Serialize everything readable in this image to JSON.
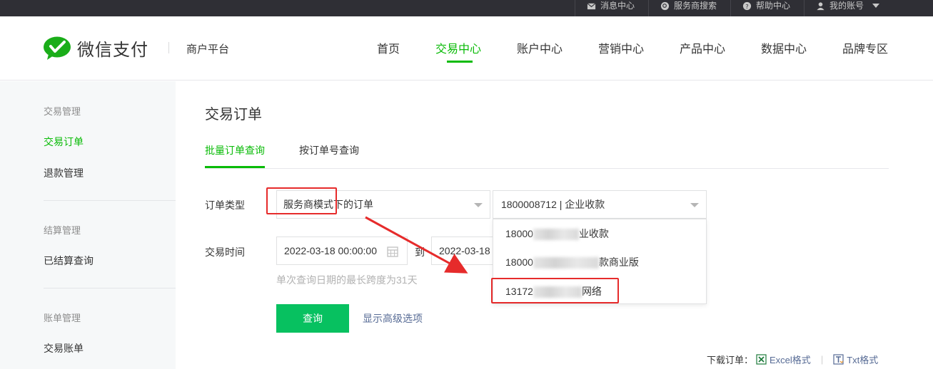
{
  "topbar": {
    "items": [
      "消息中心",
      "服务商搜索",
      "帮助中心",
      "我的账号"
    ]
  },
  "header": {
    "logo_text": "微信支付",
    "platform": "商户平台",
    "nav": [
      "首页",
      "交易中心",
      "账户中心",
      "营销中心",
      "产品中心",
      "数据中心",
      "品牌专区"
    ],
    "active_nav": "交易中心"
  },
  "sidebar": {
    "groups": [
      {
        "title": "交易管理",
        "items": [
          "交易订单",
          "退款管理"
        ]
      },
      {
        "title": "结算管理",
        "items": [
          "已结算查询"
        ]
      },
      {
        "title": "账单管理",
        "items": [
          "交易账单"
        ]
      }
    ],
    "active_item": "交易订单"
  },
  "main": {
    "title": "交易订单",
    "tabs": [
      "批量订单查询",
      "按订单号查询"
    ],
    "active_tab": "批量订单查询",
    "order_type_label": "订单类型",
    "order_type_value": "服务商模式下的订单",
    "merchant_value": "1800008712 | 企业收款",
    "merchant_options": [
      {
        "prefix": "18000",
        "suffix": "业收款"
      },
      {
        "prefix": "18000",
        "suffix": "款商业版"
      },
      {
        "prefix": "13172",
        "suffix": "网络"
      }
    ],
    "time_label": "交易时间",
    "start_time": "2022-03-18 00:00:00",
    "to_label": "到",
    "end_time": "2022-03-18",
    "hint": "单次查询日期的最长跨度为31天",
    "query_button": "查询",
    "advanced_link": "显示高级选项"
  },
  "download": {
    "label": "下载订单：",
    "excel": "Excel格式",
    "separator": "|",
    "txt": "Txt格式"
  },
  "colors": {
    "brand_green": "#09bb07",
    "button_green": "#07c160",
    "link_blue": "#576b95",
    "annotation_red": "#e62b2b"
  }
}
